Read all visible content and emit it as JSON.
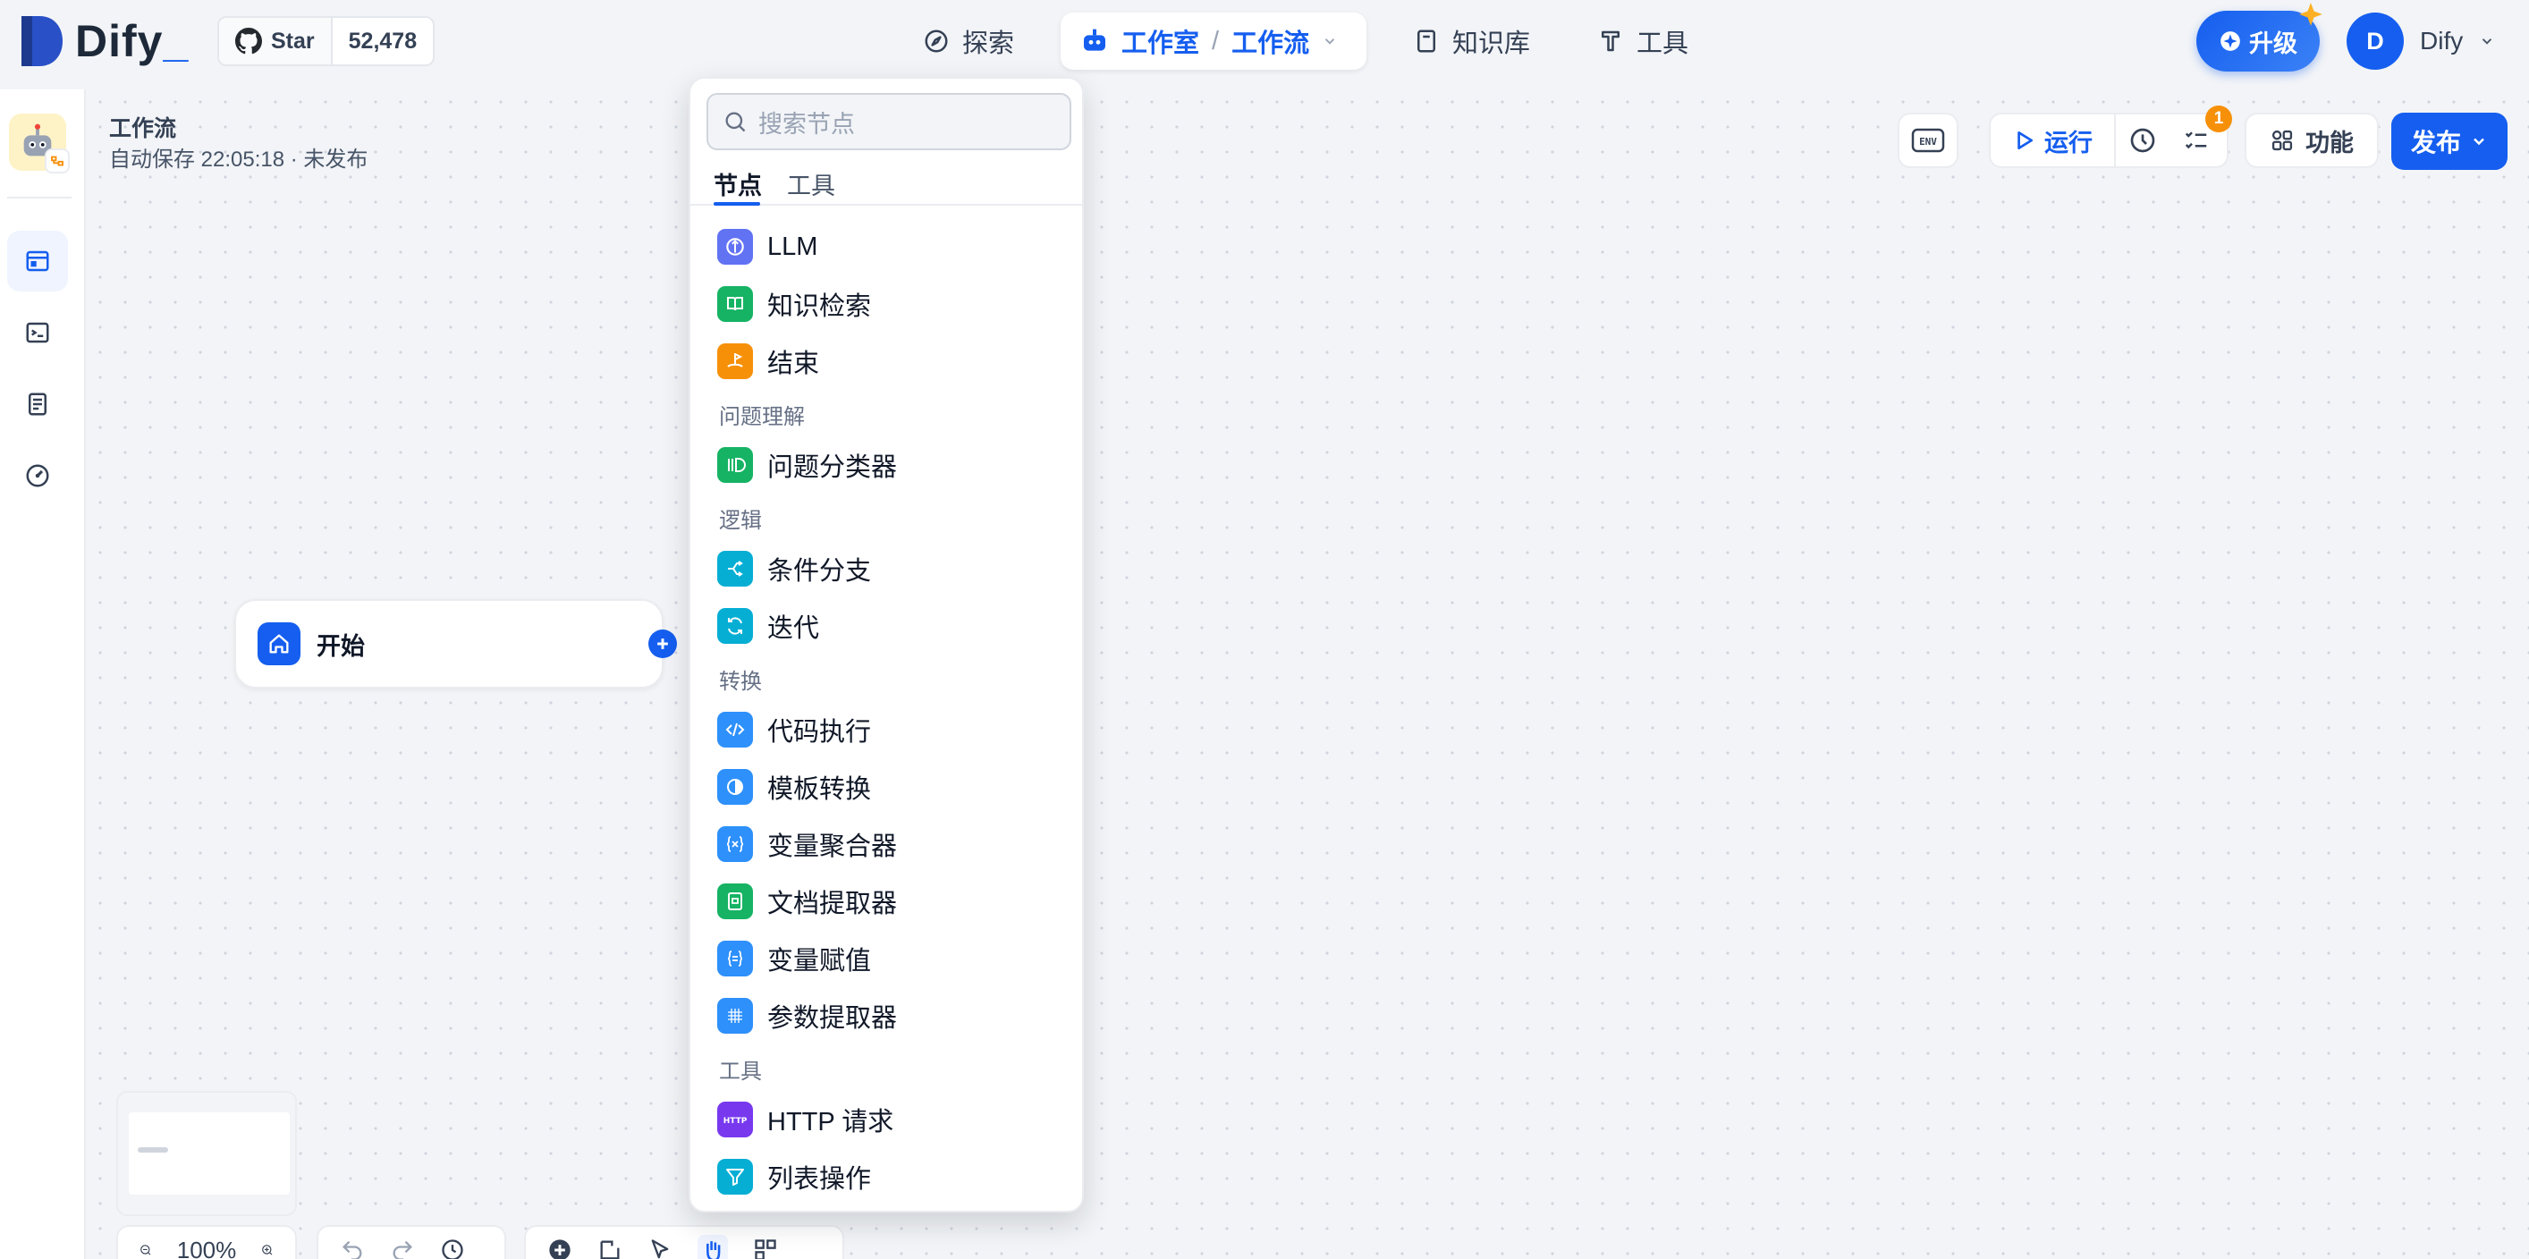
{
  "brand": {
    "name": "Dify"
  },
  "github": {
    "star_label": "Star",
    "count": "52,478"
  },
  "nav": {
    "explore": "探索",
    "studio": "工作室",
    "separator": "/",
    "studio_sub": "工作流",
    "knowledge": "知识库",
    "tools": "工具"
  },
  "upgrade_label": "升级",
  "user": {
    "initial": "D",
    "name": "Dify"
  },
  "workflow": {
    "title": "工作流",
    "status": "自动保存 22:05:18 · 未发布"
  },
  "toolbar": {
    "env": "ENV",
    "run": "运行",
    "checklist_count": "1",
    "features": "功能",
    "publish": "发布"
  },
  "node": {
    "start_label": "开始"
  },
  "bottom": {
    "zoom": "100%"
  },
  "picker": {
    "search_placeholder": "搜索节点",
    "tabs": [
      "节点",
      "工具"
    ],
    "items": [
      {
        "label": "LLM",
        "icon": "llm-icon",
        "color": "#6172f3"
      },
      {
        "label": "知识检索",
        "icon": "book-icon",
        "color": "#16b364"
      },
      {
        "label": "结束",
        "icon": "flag-icon",
        "color": "#f79009"
      },
      {
        "label": "问题分类器",
        "icon": "classifier-icon",
        "color": "#16b364"
      },
      {
        "label": "条件分支",
        "icon": "branch-icon",
        "color": "#06aed4"
      },
      {
        "label": "迭代",
        "icon": "loop-icon",
        "color": "#06aed4"
      },
      {
        "label": "代码执行",
        "icon": "code-icon",
        "color": "#2e90fa"
      },
      {
        "label": "模板转换",
        "icon": "template-icon",
        "color": "#2e90fa"
      },
      {
        "label": "变量聚合器",
        "icon": "variable-icon",
        "color": "#2e90fa"
      },
      {
        "label": "文档提取器",
        "icon": "doc-extract-icon",
        "color": "#16b364"
      },
      {
        "label": "变量赋值",
        "icon": "assign-icon",
        "color": "#2e90fa"
      },
      {
        "label": "参数提取器",
        "icon": "param-icon",
        "color": "#2e90fa"
      },
      {
        "label": "HTTP 请求",
        "icon": "http-icon",
        "color": "#7839ee"
      },
      {
        "label": "列表操作",
        "icon": "filter-icon",
        "color": "#06aed4"
      }
    ],
    "groups": [
      "问题理解",
      "逻辑",
      "转换",
      "工具"
    ],
    "http_badge": "HTTP"
  },
  "colors": {
    "accent": "#155eef"
  }
}
